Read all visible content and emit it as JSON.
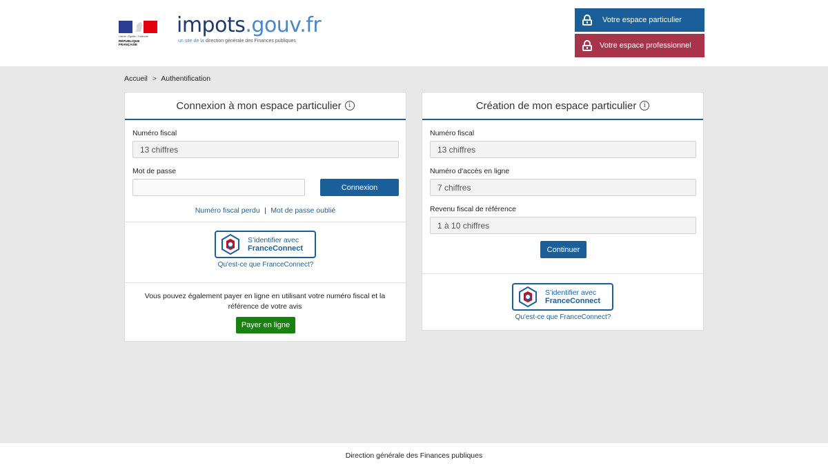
{
  "header": {
    "marianne": {
      "motto": "Liberté • Égalité • Fraternité",
      "republic": "RÉPUBLIQUE FRANÇAISE"
    },
    "brand": {
      "name_part1": "impots",
      "name_part2": ".gouv.fr",
      "subtitle_prefix": "un site de la",
      "subtitle_suffix": "direction générale des Finances publiques"
    },
    "buttons": {
      "particulier": "Votre espace particulier",
      "professionnel": "Votre espace professionnel"
    }
  },
  "breadcrumb": {
    "home": "Accueil",
    "separator": ">",
    "current": "Authentification"
  },
  "login_card": {
    "title": "Connexion à mon espace particulier",
    "info_glyph": "i",
    "fiscal_label": "Numéro fiscal",
    "fiscal_placeholder": "13 chiffres",
    "password_label": "Mot de passe",
    "password_placeholder": "",
    "connect_button": "Connexion",
    "lost_fiscal": "Numéro fiscal perdu",
    "link_separator": "|",
    "forgot_password": "Mot de passe oublié",
    "fc_line1": "S’identifier avec",
    "fc_line2": "FranceConnect",
    "fc_help": "Qu'est-ce que FranceConnect?",
    "pay_text": "Vous pouvez également payer en ligne en utilisant votre numéro fiscal et la référence de votre avis",
    "pay_button": "Payer en ligne"
  },
  "create_card": {
    "title": "Création de mon espace particulier",
    "info_glyph": "i",
    "fiscal_label": "Numéro fiscal",
    "fiscal_placeholder": "13 chiffres",
    "access_label": "Numéro d'accès en ligne",
    "access_placeholder": "7 chiffres",
    "revenue_label": "Revenu fiscal de référence",
    "revenue_placeholder": "1 à 10 chiffres",
    "continue_button": "Continuer",
    "fc_line1": "S’identifier avec",
    "fc_line2": "FranceConnect",
    "fc_help": "Qu'est-ce que FranceConnect?"
  },
  "footer": {
    "text": "Direction générale des Finances publiques"
  },
  "colors": {
    "primary_blue": "#1a5f99",
    "pro_red": "#a8344b",
    "pay_green": "#19810f",
    "background_grey": "#e8e8e8"
  }
}
